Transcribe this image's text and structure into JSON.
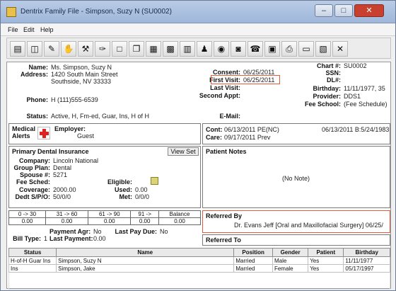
{
  "window": {
    "title": "Dentrix Family File - Simpson, Suzy N (SU0002)",
    "btn_min": "–",
    "btn_max": "□",
    "btn_close": "✕",
    "close_color": "#c8412e"
  },
  "menu": [
    "File",
    "Edit",
    "Help"
  ],
  "toolbar_icons": [
    "document-icon",
    "ruler-icon",
    "tooth-icon",
    "hand-icon",
    "tools-icon",
    "pen-icon",
    "square-icon",
    "copy-icon",
    "table-icon",
    "grid-icon",
    "chart-icon",
    "person-icon",
    "globe-icon",
    "camera-icon",
    "phone-icon",
    "calendar-icon",
    "print-icon",
    "doc-icon",
    "graph-icon",
    "close-icon"
  ],
  "patient": {
    "name_label": "Name:",
    "name": "Ms. Simpson, Suzy N",
    "address_label": "Address:",
    "address1": "1420 South Main Street",
    "address2": "Southside, NV 33333",
    "phone_label": "Phone:",
    "phone": "H (111)555-6539",
    "status_label": "Status:",
    "status": "Active, H, Fm-ed, Guar, Ins, H of H"
  },
  "right_info": {
    "chart_label": "Chart #:",
    "chart": "SU0002",
    "ssn_label": "SSN:",
    "ssn": "",
    "dl_label": "DL#:",
    "dl": "",
    "consent_label": "Consent:",
    "consent": "06/25/2011",
    "birthday_label": "Birthday:",
    "birthday": "11/11/1977, 35",
    "first_visit_label": "First Visit:",
    "first_visit": "06/25/2011",
    "provider_label": "Provider:",
    "provider": "DDS1",
    "last_visit_label": "Last Visit:",
    "last_visit": "",
    "fee_sched_label": "Fee School:",
    "fee_sched": "(Fee Schedule)",
    "second_appt_label": "Second Appt:",
    "second_appt": "",
    "email_label": "E-Mail:",
    "email": ""
  },
  "medical": {
    "label": "Medical Alerts",
    "employer_label": "Employer:",
    "employer": "Guest"
  },
  "cont": {
    "cont_label": "Cont:",
    "cont_value": "06/13/2011 PE(NC)",
    "cont_right": "06/13/2011 B:5/24/1983",
    "care_label": "Care:",
    "care_value": "09/17/2011 Prev"
  },
  "insurance": {
    "title": "Primary Dental Insurance",
    "viewset": "View Set",
    "company_label": "Company:",
    "company": "Lincoln National",
    "group_label": "Group Plan:",
    "group": "Dental",
    "spouse_label": "Spouse #:",
    "spouse": "5271",
    "fee_label": "Fee Sched:",
    "fee": "",
    "eligible_label": "Eligible:",
    "coverage_label": "Coverage:",
    "coverage": "2000.00",
    "used_label": "Used:",
    "used": "0.00",
    "deduct_label": "Dedt S/P/O:",
    "deduct": "50/0/0",
    "met_label": "Met:",
    "met": "0/0/0"
  },
  "coverage_table": {
    "headers": [
      "0 -> 30",
      "31 -> 60",
      "61 -> 90",
      "91 ->",
      "Balance"
    ],
    "values": [
      "0.00",
      "0.00",
      "0.00",
      "0.00",
      "0.00"
    ]
  },
  "payment": {
    "pay_label": "Payment Agr:",
    "pay": "No",
    "last_pay_label": "Last Pay Due:",
    "last_pay": "No",
    "bill_label": "Bill Type:",
    "bill": "1",
    "last_payment_label": "Last Payment:",
    "last_payment": "0.00"
  },
  "notes": {
    "title": "Patient Notes",
    "body": "(No Note)"
  },
  "referred_by": {
    "title": "Referred By",
    "value": "Dr. Evans Jeff [Oral and Maxillofacial Surgery] 06/25/"
  },
  "referred_to": {
    "title": "Referred To"
  },
  "grid": {
    "headers": [
      "Status",
      "Name",
      "Position",
      "Gender",
      "Patient",
      "Birthday"
    ],
    "rows": [
      [
        "H-of-H Guar Ins",
        "Simpson, Suzy N",
        "Married",
        "Male",
        "Yes",
        "11/11/1977"
      ],
      [
        "Ins",
        "Simpson, Jake",
        "Married",
        "Female",
        "Yes",
        "05/17/1997"
      ]
    ]
  },
  "colors": {
    "accent_red": "#e35b3a"
  }
}
